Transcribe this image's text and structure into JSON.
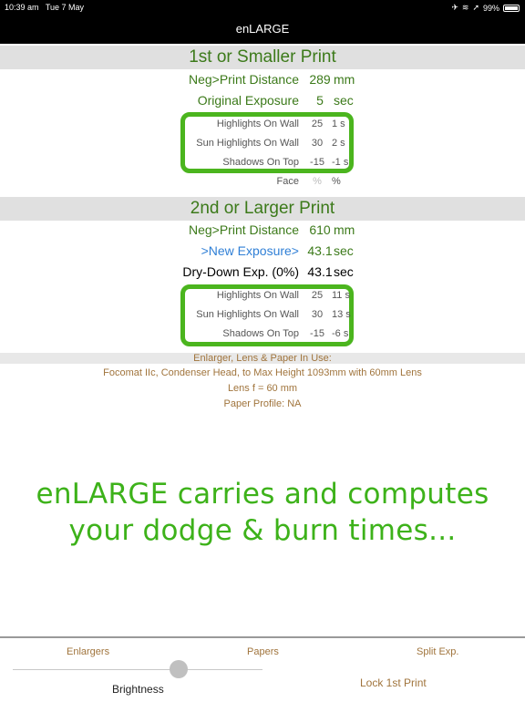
{
  "status": {
    "time": "10:39 am",
    "date": "Tue 7 May",
    "battery": "99%"
  },
  "nav": {
    "title": "enLARGE"
  },
  "first": {
    "header": "1st or Smaller Print",
    "distance": {
      "label": "Neg>Print Distance",
      "value": "289",
      "unit": "mm"
    },
    "exposure": {
      "label": "Original Exposure",
      "value": "5",
      "unit": "sec"
    },
    "rows": [
      {
        "label": "Highlights On Wall",
        "value": "25",
        "time": "1 s"
      },
      {
        "label": "Sun Highlights On Wall",
        "value": "30",
        "time": "2 s"
      },
      {
        "label": "Shadows On Top",
        "value": "-15",
        "time": "-1 s"
      }
    ],
    "face": {
      "label": "Face",
      "value": "%",
      "time": "%"
    }
  },
  "second": {
    "header": "2nd or Larger Print",
    "distance": {
      "label": "Neg>Print Distance",
      "value": "610",
      "unit": "mm"
    },
    "new_exposure": {
      "label": ">New Exposure>",
      "value": "43.1",
      "unit": "sec"
    },
    "dry_down": {
      "label": "Dry-Down Exp. (0%)",
      "value": "43.1",
      "unit": "sec"
    },
    "rows": [
      {
        "label": "Highlights On Wall",
        "value": "25",
        "time": "11 s"
      },
      {
        "label": "Sun Highlights On Wall",
        "value": "30",
        "time": "13 s"
      },
      {
        "label": "Shadows On Top",
        "value": "-15",
        "time": "-6 s"
      }
    ]
  },
  "enlarger": {
    "header": "Enlarger, Lens & Paper In Use:",
    "line1": "Focomat IIc, Condenser Head, to Max Height 1093mm with 60mm Lens",
    "line2": "Lens f = 60 mm",
    "line3": "Paper Profile: NA"
  },
  "promo": {
    "line1": "enLARGE carries and computes",
    "line2": "your dodge & burn times..."
  },
  "toolbar": {
    "enlargers": "Enlargers",
    "papers": "Papers",
    "split": "Split Exp.",
    "brightness": "Brightness",
    "lock": "Lock 1st Print"
  }
}
